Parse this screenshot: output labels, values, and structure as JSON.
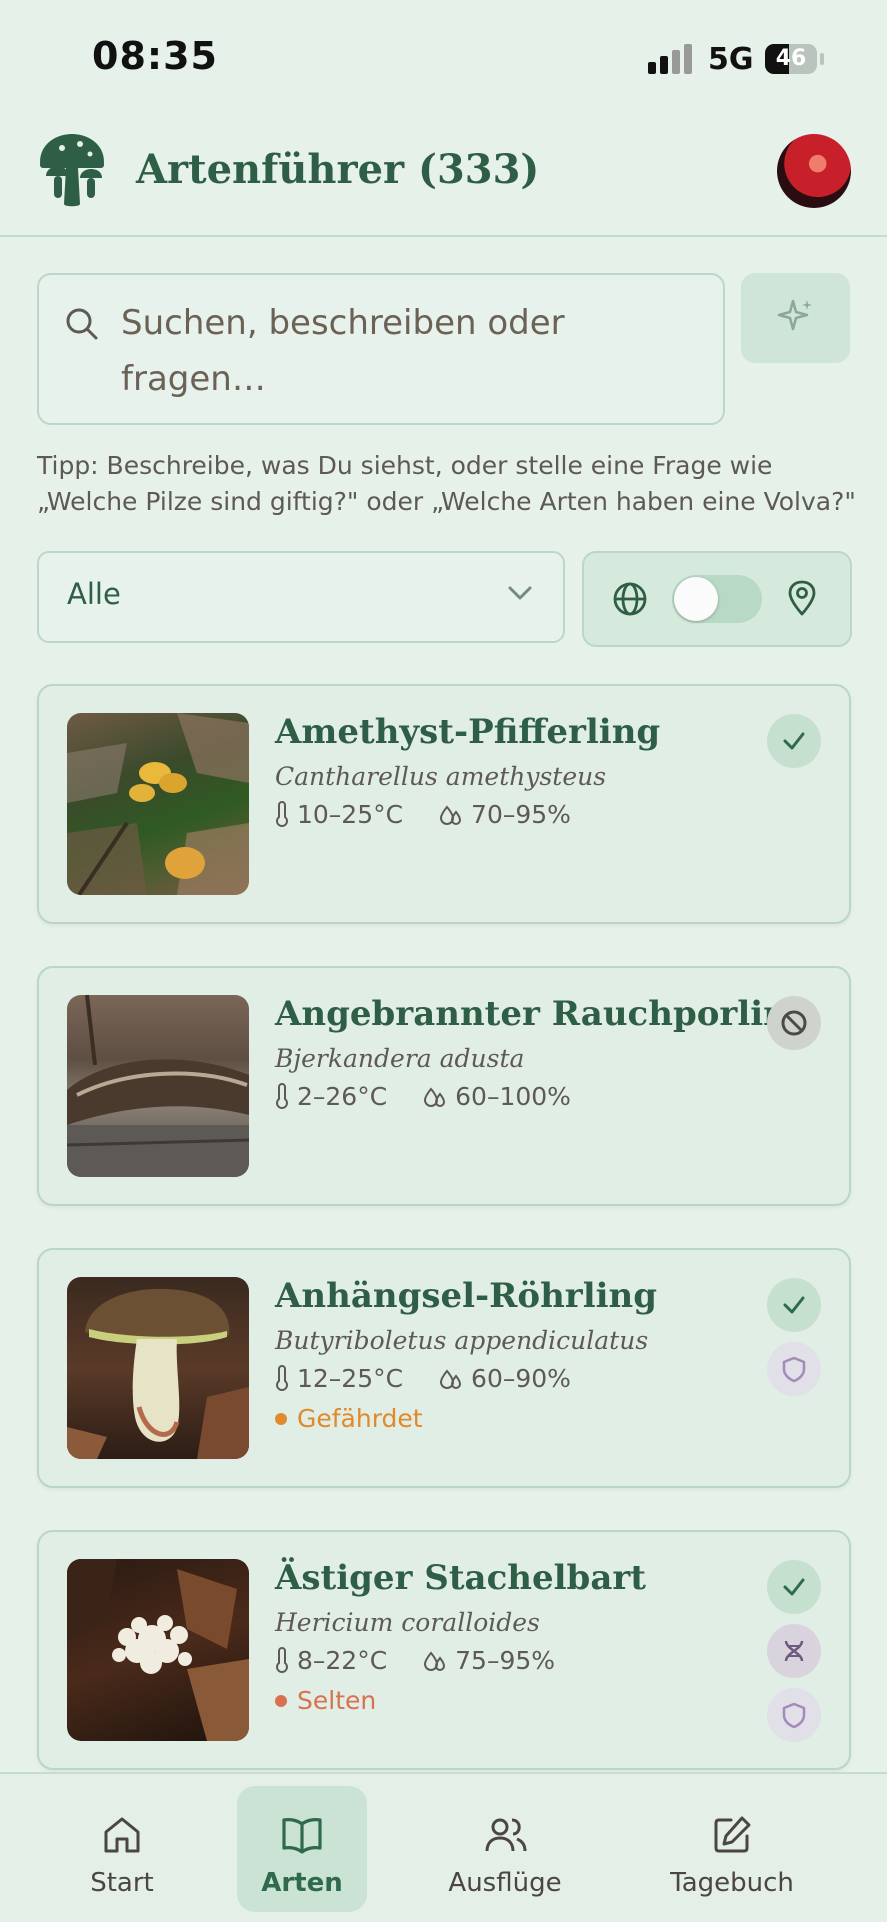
{
  "status_bar": {
    "time": "08:35",
    "network": "5G",
    "battery": "46",
    "battery_level": 0.46
  },
  "header": {
    "title": "Artenführer (333)",
    "logo_icon": "mushroom-logo-icon",
    "avatar": "user-avatar"
  },
  "search": {
    "placeholder": "Suchen, beschreiben oder fragen…",
    "ai_icon": "sparkle-icon"
  },
  "tip": "Tipp: Beschreibe, was Du siehst, oder stelle eine Frage wie „Welche Pilze sind giftig?\" oder „Welche Arten haben eine Volva?\"",
  "filter": {
    "selected": "Alle"
  },
  "location_toggle": {
    "global_icon": "globe-icon",
    "local_icon": "map-pin-icon",
    "enabled": false
  },
  "species": [
    {
      "name": "Amethyst-Pfifferling",
      "latin": "Cantharellus amethysteus",
      "temp": "10–25°C",
      "humidity": "70–95%",
      "status": "",
      "status_color": "",
      "badges": [
        "edible"
      ]
    },
    {
      "name": "Angebrannter Rauchporling",
      "latin": "Bjerkandera adusta",
      "temp": "2–26°C",
      "humidity": "60–100%",
      "status": "",
      "status_color": "",
      "badges": [
        "not-edible"
      ]
    },
    {
      "name": "Anhängsel-Röhrling",
      "latin": "Butyriboletus appendiculatus",
      "temp": "12–25°C",
      "humidity": "60–90%",
      "status": "Gefährdet",
      "status_color": "#e08a2c",
      "badges": [
        "edible",
        "protected"
      ]
    },
    {
      "name": "Ästiger Stachelbart",
      "latin": "Hericium coralloides",
      "temp": "8–22°C",
      "humidity": "75–95%",
      "status": "Selten",
      "status_color": "#d9714f",
      "badges": [
        "edible",
        "dna",
        "protected"
      ]
    }
  ],
  "nav": [
    {
      "label": "Start",
      "icon": "home-icon",
      "active": false
    },
    {
      "label": "Arten",
      "icon": "book-icon",
      "active": true
    },
    {
      "label": "Ausflüge",
      "icon": "users-icon",
      "active": false
    },
    {
      "label": "Tagebuch",
      "icon": "edit-icon",
      "active": false
    }
  ]
}
